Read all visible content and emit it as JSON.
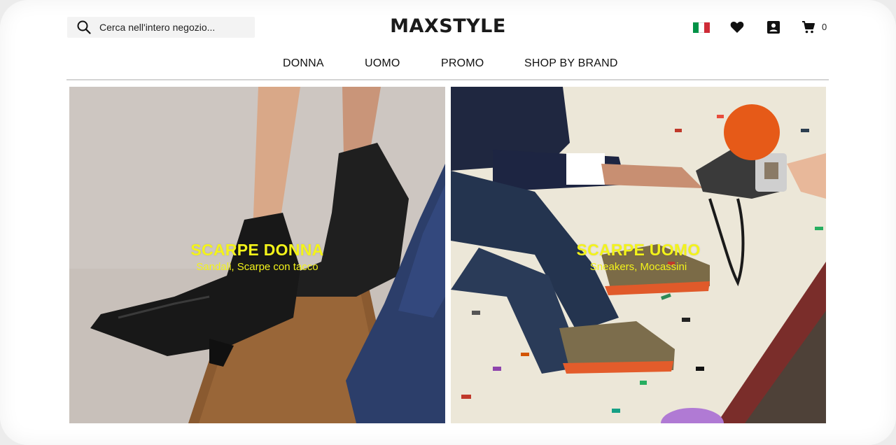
{
  "header": {
    "search": {
      "placeholder": "Cerca nell'intero negozio..."
    },
    "logo": "MAXSTYLE",
    "language_flag": "italy-flag-icon",
    "cart_count": "0",
    "icons": [
      "search-icon",
      "heart-icon",
      "account-icon",
      "cart-icon"
    ]
  },
  "nav": {
    "items": [
      {
        "label": "DONNA"
      },
      {
        "label": "UOMO"
      },
      {
        "label": "PROMO"
      },
      {
        "label": "SHOP BY BRAND"
      }
    ]
  },
  "banners": [
    {
      "title": "SCARPE DONNA",
      "subtitle": "Sandali, Scarpe con tacco"
    },
    {
      "title": "SCARPE UOMO",
      "subtitle": "Sneakers, Mocassini"
    }
  ],
  "colors": {
    "banner_text": "#f3f31a",
    "flag_green": "#009246",
    "flag_white": "#ffffff",
    "flag_red": "#ce2b37"
  }
}
